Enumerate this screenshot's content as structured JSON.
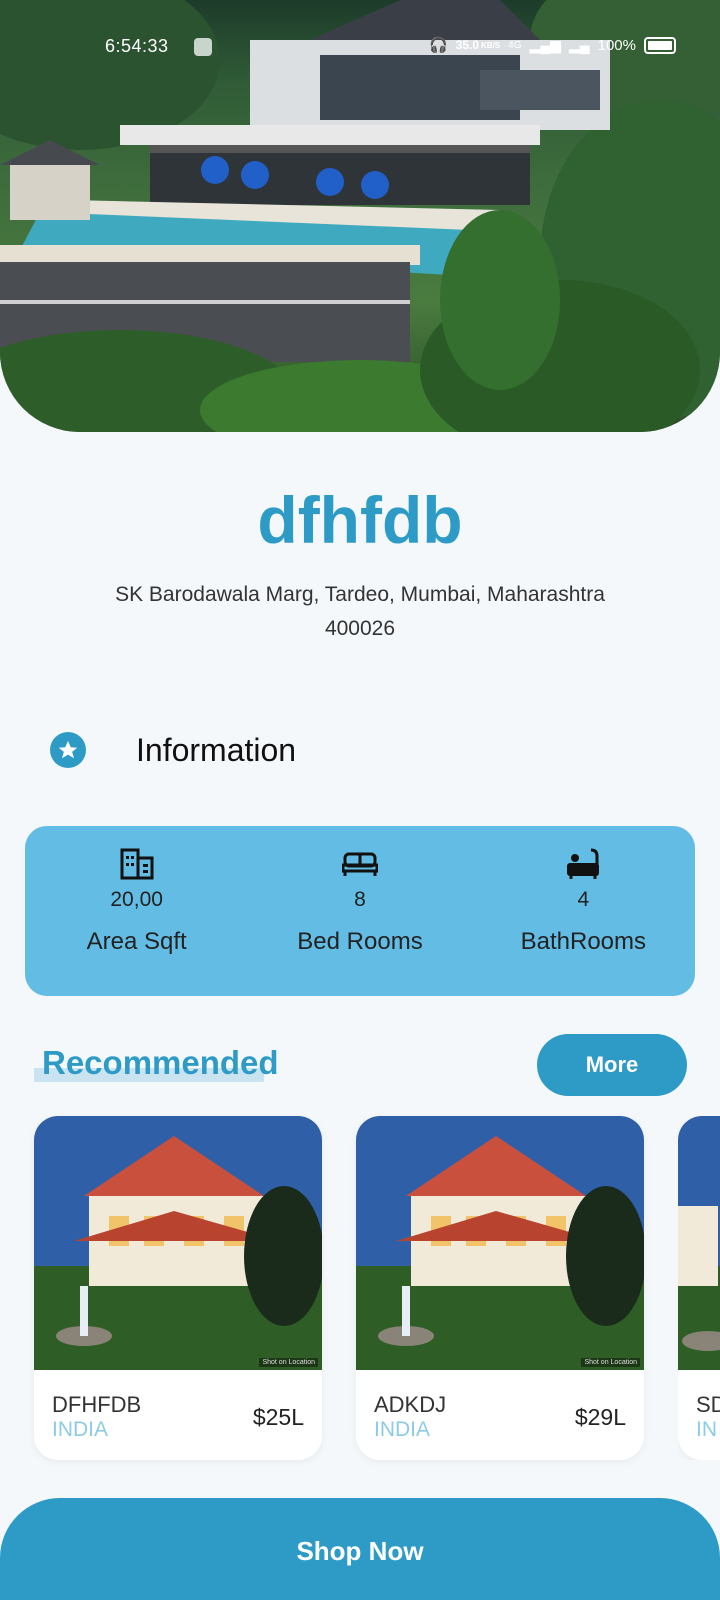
{
  "status_bar": {
    "time": "6:54:33",
    "net_speed": "35.0",
    "net_unit": "KB/S",
    "network": "4G",
    "battery": "100%"
  },
  "property": {
    "name": "dfhfdb",
    "address": "SK Barodawala Marg, Tardeo, Mumbai, Maharashtra 400026"
  },
  "info_section": {
    "label": "Information",
    "icon": "star-icon"
  },
  "stats": [
    {
      "icon": "building-icon",
      "value": "20,00",
      "label": "Area Sqft"
    },
    {
      "icon": "bed-icon",
      "value": "8",
      "label": "Bed Rooms"
    },
    {
      "icon": "bathtub-icon",
      "value": "4",
      "label": "BathRooms"
    }
  ],
  "recommended": {
    "title": "Recommended",
    "more_label": "More",
    "watermark": "Shot on Location",
    "items": [
      {
        "name": "DFHFDB",
        "country": "INDIA",
        "price": "$25L"
      },
      {
        "name": "ADKDJ",
        "country": "INDIA",
        "price": "$29L"
      },
      {
        "name": "SD",
        "country": "IN",
        "price": ""
      }
    ]
  },
  "cta": {
    "label": "Shop Now"
  },
  "colors": {
    "accent": "#2e9bc7",
    "stats_bg": "#62bce3",
    "country": "#8dcbe5"
  }
}
